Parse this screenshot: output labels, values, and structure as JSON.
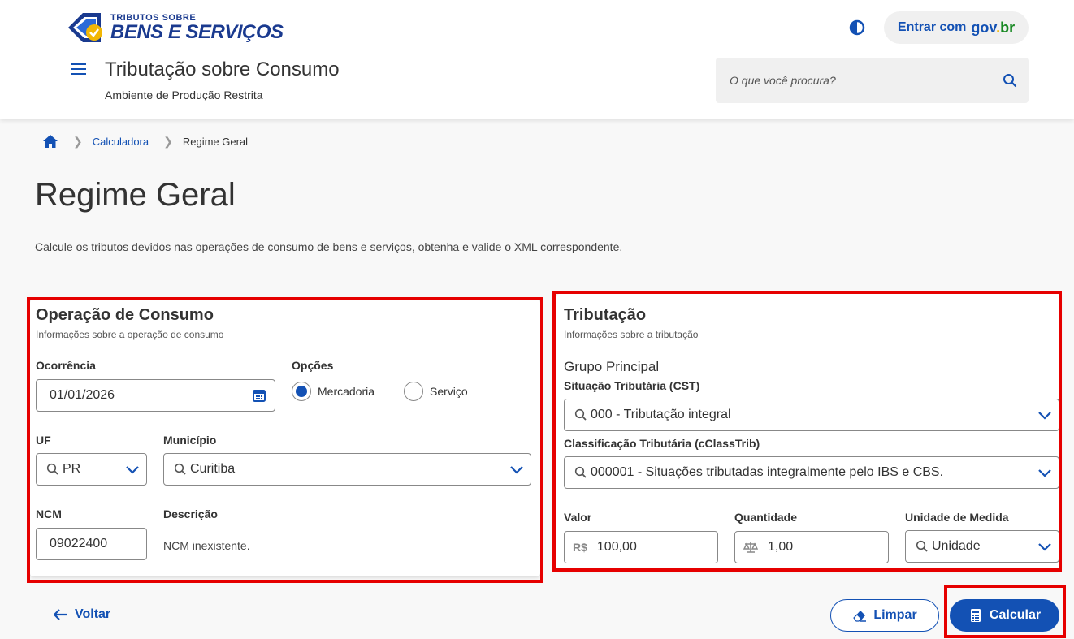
{
  "header": {
    "logo_small": "TRIBUTOS SOBRE",
    "logo_big": "BENS E SERVIÇOS",
    "login_label": "Entrar com",
    "login_gov": [
      "gov",
      ".",
      "br"
    ],
    "app_title": "Tributação sobre Consumo",
    "app_subtitle": "Ambiente de Produção Restrita",
    "search_placeholder": "O que você procura?"
  },
  "breadcrumb": {
    "items": [
      "Calculadora",
      "Regime Geral"
    ]
  },
  "page": {
    "title": "Regime Geral",
    "description": "Calcule os tributos devidos nas operações de consumo de bens e serviços, obtenha e valide o XML correspondente."
  },
  "operacao": {
    "title": "Operação de Consumo",
    "subtitle": "Informações sobre a operação de consumo",
    "ocorrencia_label": "Ocorrência",
    "ocorrencia_value": "01/01/2026",
    "opcoes_label": "Opções",
    "opcoes": [
      {
        "label": "Mercadoria",
        "selected": true
      },
      {
        "label": "Serviço",
        "selected": false
      }
    ],
    "uf_label": "UF",
    "uf_value": "PR",
    "municipio_label": "Município",
    "municipio_value": "Curitiba",
    "ncm_label": "NCM",
    "ncm_value": "09022400",
    "descricao_label": "Descrição",
    "descricao_value": "NCM inexistente."
  },
  "tributacao": {
    "title": "Tributação",
    "subtitle": "Informações sobre a tributação",
    "grupo_label": "Grupo Principal",
    "cst_label": "Situação Tributária (CST)",
    "cst_value": "000 - Tributação integral",
    "cclass_label": "Classificação Tributária (cClassTrib)",
    "cclass_value": "000001 - Situações tributadas integralmente pelo IBS e CBS.",
    "valor_label": "Valor",
    "valor_prefix": "R$",
    "valor_value": "100,00",
    "quantidade_label": "Quantidade",
    "quantidade_value": "1,00",
    "unidade_label": "Unidade de Medida",
    "unidade_value": "Unidade"
  },
  "actions": {
    "back": "Voltar",
    "clear": "Limpar",
    "calculate": "Calcular"
  },
  "colors": {
    "primary": "#1351b4",
    "highlight": "#e60000"
  }
}
